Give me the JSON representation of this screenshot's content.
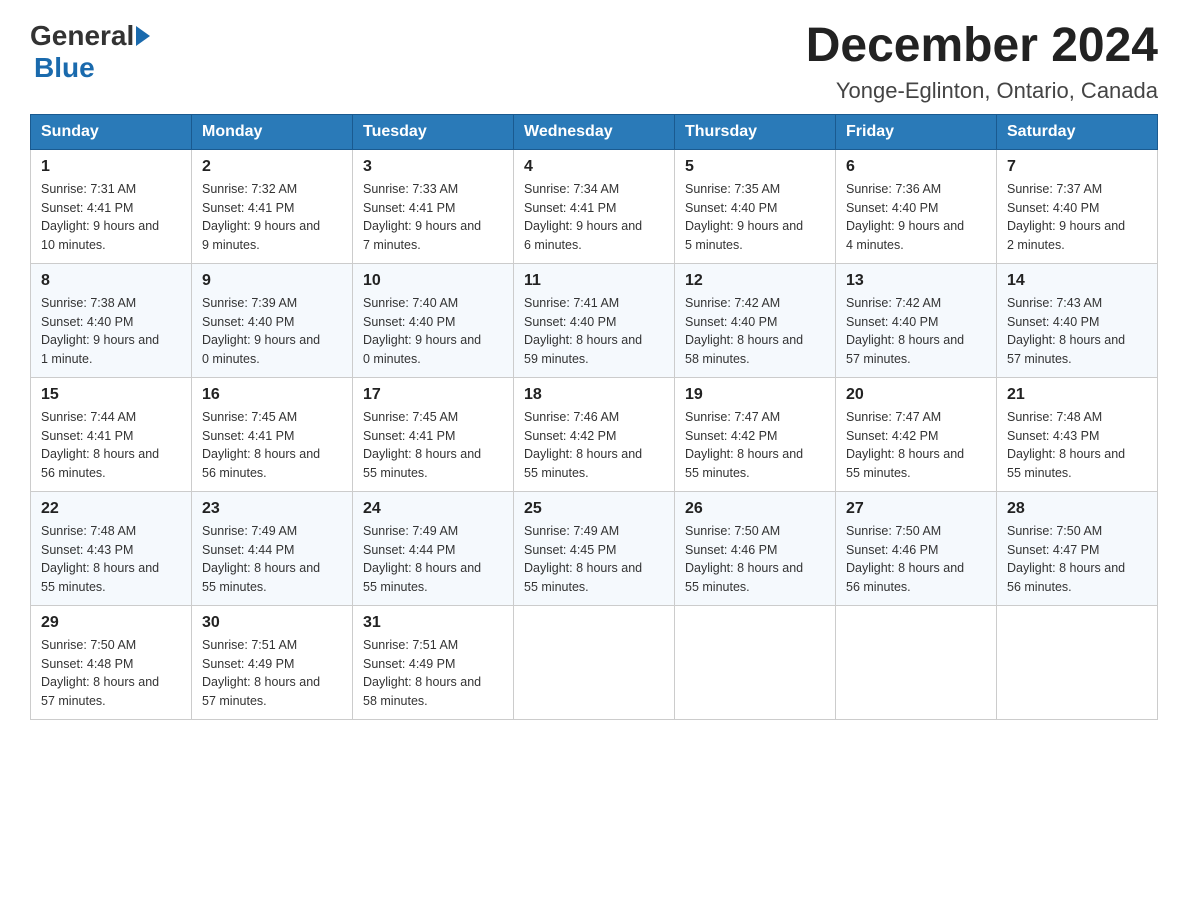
{
  "logo": {
    "general": "General",
    "blue": "Blue"
  },
  "header": {
    "month": "December 2024",
    "location": "Yonge-Eglinton, Ontario, Canada"
  },
  "days_of_week": [
    "Sunday",
    "Monday",
    "Tuesday",
    "Wednesday",
    "Thursday",
    "Friday",
    "Saturday"
  ],
  "weeks": [
    [
      {
        "day": "1",
        "sunrise": "7:31 AM",
        "sunset": "4:41 PM",
        "daylight": "9 hours and 10 minutes."
      },
      {
        "day": "2",
        "sunrise": "7:32 AM",
        "sunset": "4:41 PM",
        "daylight": "9 hours and 9 minutes."
      },
      {
        "day": "3",
        "sunrise": "7:33 AM",
        "sunset": "4:41 PM",
        "daylight": "9 hours and 7 minutes."
      },
      {
        "day": "4",
        "sunrise": "7:34 AM",
        "sunset": "4:41 PM",
        "daylight": "9 hours and 6 minutes."
      },
      {
        "day": "5",
        "sunrise": "7:35 AM",
        "sunset": "4:40 PM",
        "daylight": "9 hours and 5 minutes."
      },
      {
        "day": "6",
        "sunrise": "7:36 AM",
        "sunset": "4:40 PM",
        "daylight": "9 hours and 4 minutes."
      },
      {
        "day": "7",
        "sunrise": "7:37 AM",
        "sunset": "4:40 PM",
        "daylight": "9 hours and 2 minutes."
      }
    ],
    [
      {
        "day": "8",
        "sunrise": "7:38 AM",
        "sunset": "4:40 PM",
        "daylight": "9 hours and 1 minute."
      },
      {
        "day": "9",
        "sunrise": "7:39 AM",
        "sunset": "4:40 PM",
        "daylight": "9 hours and 0 minutes."
      },
      {
        "day": "10",
        "sunrise": "7:40 AM",
        "sunset": "4:40 PM",
        "daylight": "9 hours and 0 minutes."
      },
      {
        "day": "11",
        "sunrise": "7:41 AM",
        "sunset": "4:40 PM",
        "daylight": "8 hours and 59 minutes."
      },
      {
        "day": "12",
        "sunrise": "7:42 AM",
        "sunset": "4:40 PM",
        "daylight": "8 hours and 58 minutes."
      },
      {
        "day": "13",
        "sunrise": "7:42 AM",
        "sunset": "4:40 PM",
        "daylight": "8 hours and 57 minutes."
      },
      {
        "day": "14",
        "sunrise": "7:43 AM",
        "sunset": "4:40 PM",
        "daylight": "8 hours and 57 minutes."
      }
    ],
    [
      {
        "day": "15",
        "sunrise": "7:44 AM",
        "sunset": "4:41 PM",
        "daylight": "8 hours and 56 minutes."
      },
      {
        "day": "16",
        "sunrise": "7:45 AM",
        "sunset": "4:41 PM",
        "daylight": "8 hours and 56 minutes."
      },
      {
        "day": "17",
        "sunrise": "7:45 AM",
        "sunset": "4:41 PM",
        "daylight": "8 hours and 55 minutes."
      },
      {
        "day": "18",
        "sunrise": "7:46 AM",
        "sunset": "4:42 PM",
        "daylight": "8 hours and 55 minutes."
      },
      {
        "day": "19",
        "sunrise": "7:47 AM",
        "sunset": "4:42 PM",
        "daylight": "8 hours and 55 minutes."
      },
      {
        "day": "20",
        "sunrise": "7:47 AM",
        "sunset": "4:42 PM",
        "daylight": "8 hours and 55 minutes."
      },
      {
        "day": "21",
        "sunrise": "7:48 AM",
        "sunset": "4:43 PM",
        "daylight": "8 hours and 55 minutes."
      }
    ],
    [
      {
        "day": "22",
        "sunrise": "7:48 AM",
        "sunset": "4:43 PM",
        "daylight": "8 hours and 55 minutes."
      },
      {
        "day": "23",
        "sunrise": "7:49 AM",
        "sunset": "4:44 PM",
        "daylight": "8 hours and 55 minutes."
      },
      {
        "day": "24",
        "sunrise": "7:49 AM",
        "sunset": "4:44 PM",
        "daylight": "8 hours and 55 minutes."
      },
      {
        "day": "25",
        "sunrise": "7:49 AM",
        "sunset": "4:45 PM",
        "daylight": "8 hours and 55 minutes."
      },
      {
        "day": "26",
        "sunrise": "7:50 AM",
        "sunset": "4:46 PM",
        "daylight": "8 hours and 55 minutes."
      },
      {
        "day": "27",
        "sunrise": "7:50 AM",
        "sunset": "4:46 PM",
        "daylight": "8 hours and 56 minutes."
      },
      {
        "day": "28",
        "sunrise": "7:50 AM",
        "sunset": "4:47 PM",
        "daylight": "8 hours and 56 minutes."
      }
    ],
    [
      {
        "day": "29",
        "sunrise": "7:50 AM",
        "sunset": "4:48 PM",
        "daylight": "8 hours and 57 minutes."
      },
      {
        "day": "30",
        "sunrise": "7:51 AM",
        "sunset": "4:49 PM",
        "daylight": "8 hours and 57 minutes."
      },
      {
        "day": "31",
        "sunrise": "7:51 AM",
        "sunset": "4:49 PM",
        "daylight": "8 hours and 58 minutes."
      },
      null,
      null,
      null,
      null
    ]
  ],
  "labels": {
    "sunrise": "Sunrise:",
    "sunset": "Sunset:",
    "daylight": "Daylight:"
  }
}
